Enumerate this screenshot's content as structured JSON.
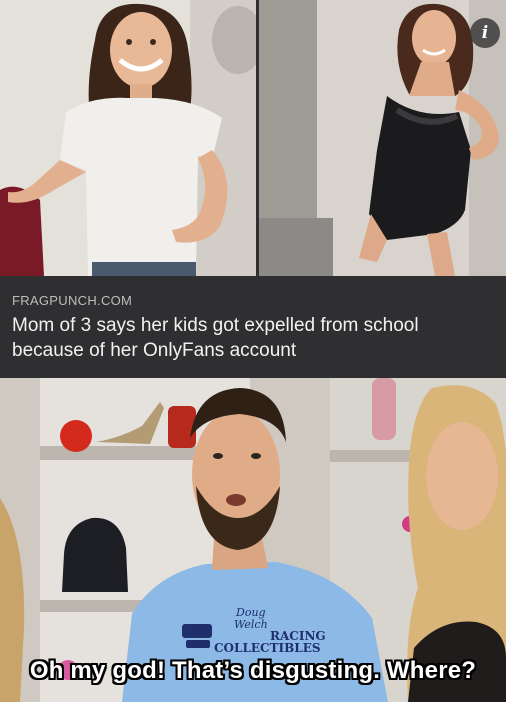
{
  "card": {
    "source": "FRAGPUNCH.COM",
    "headline": "Mom of 3 says her kids got expelled from school because of her OnlyFans account",
    "info_icon_glyph": "i",
    "info_icon": "info-icon",
    "background": "#2f2f31"
  },
  "meme": {
    "caption": "Oh my god! That’s disgusting. Where?",
    "shirt_text_line1": "Doug",
    "shirt_text_line2": "Welch",
    "shirt_text_line3": "RACING",
    "shirt_text_line4": "COLLECTIBLES"
  },
  "colors": {
    "headline": "#f2f2f2",
    "source": "#bdbdbd",
    "shirt": "#8cb9e6",
    "caption": "#ffffff"
  }
}
